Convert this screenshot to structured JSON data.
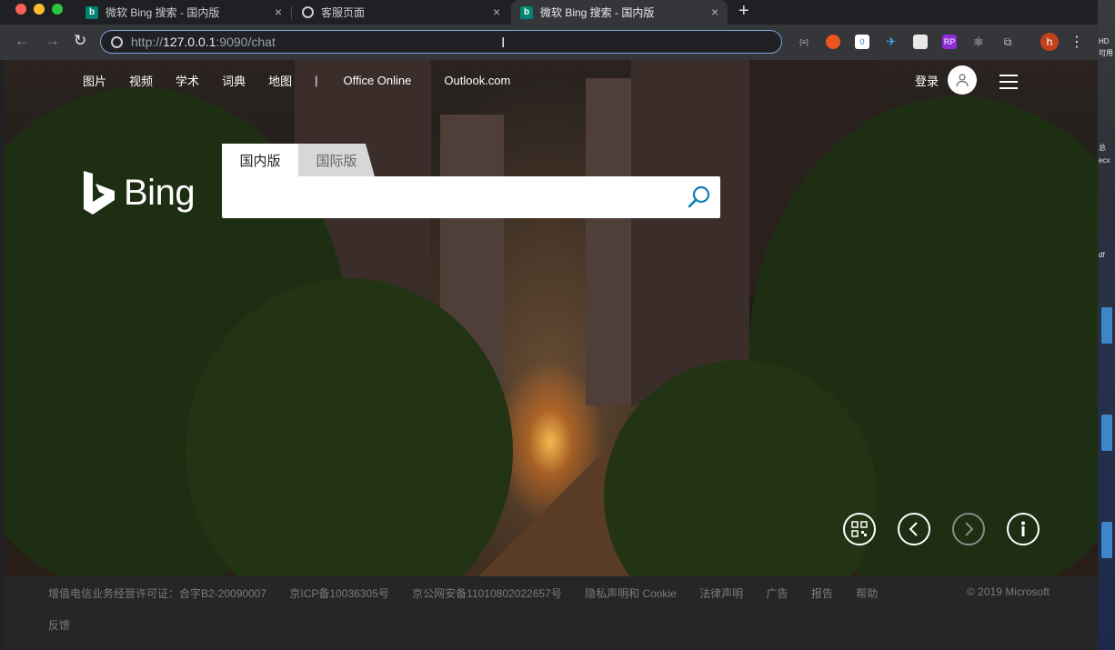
{
  "browser": {
    "tabs": [
      {
        "title": "微软 Bing 搜索 - 国内版",
        "favicon": "bing-icon"
      },
      {
        "title": "客服页面",
        "favicon": "globe-icon"
      },
      {
        "title": "微软 Bing 搜索 - 国内版",
        "favicon": "bing-icon",
        "active": true
      }
    ],
    "new_tab": "+",
    "url_prefix": "http://",
    "url_host": "127.0.0.1",
    "url_rest": ":9090/chat",
    "profile_initial": "h",
    "extensions": [
      "json-icon",
      "ubuntu-icon",
      "counter-icon",
      "bird-icon",
      "ad-icon",
      "rp-icon",
      "react-icon",
      "puzzle-icon"
    ],
    "extension_text": {
      "counter": "0",
      "rp": "RP",
      "json": "{≡}"
    }
  },
  "bing": {
    "nav": [
      "图片",
      "视频",
      "学术",
      "词典",
      "地图"
    ],
    "nav_divider": "|",
    "nav_links": [
      "Office Online",
      "Outlook.com"
    ],
    "login": "登录",
    "logo_text": "Bing",
    "search_tabs": [
      "国内版",
      "国际版"
    ],
    "search_value": ""
  },
  "footer": {
    "links": [
      "增值电信业务经营许可证：合字B2-20090007",
      "京ICP备10036305号",
      "京公网安备11010802022657号",
      "隐私声明和 Cookie",
      "法律声明",
      "广告",
      "报告",
      "帮助"
    ],
    "copyright": "© 2019 Microsoft",
    "feedback": "反馈"
  },
  "desktop": {
    "strip_text": [
      "HD",
      "可用",
      "总",
      "ecx",
      "df"
    ]
  },
  "colors": {
    "accent": "#7aa7d8",
    "bing_teal": "#008373",
    "footer_bg": "#262626"
  }
}
